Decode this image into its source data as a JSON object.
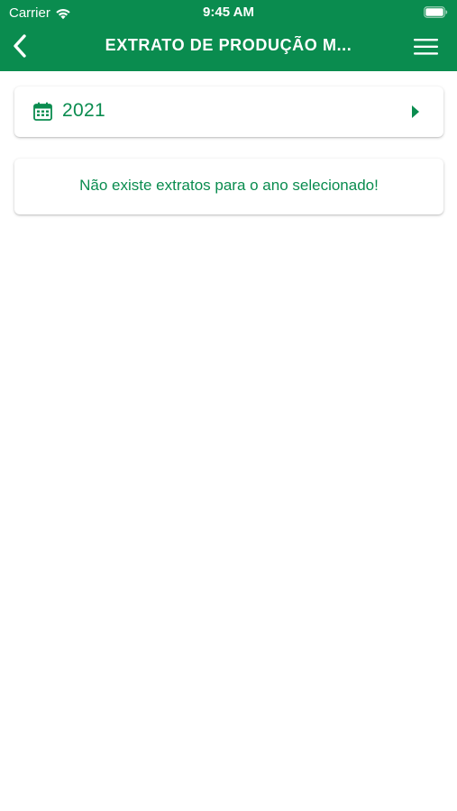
{
  "colors": {
    "brand_green": "#0a8c4f",
    "header_text": "#ffffff",
    "background": "#ffffff"
  },
  "status_bar": {
    "carrier": "Carrier",
    "time": "9:45 AM",
    "wifi_icon": "wifi-icon",
    "battery_icon": "battery-icon"
  },
  "nav_bar": {
    "title": "EXTRATO DE PRODUÇÃO M...",
    "back_icon": "chevron-left-icon",
    "menu_icon": "hamburger-menu-icon"
  },
  "year_selector": {
    "icon": "calendar-icon",
    "year": "2021",
    "next_icon": "caret-right-icon"
  },
  "empty_state": {
    "message": "Não existe extratos para o ano selecionado!"
  }
}
